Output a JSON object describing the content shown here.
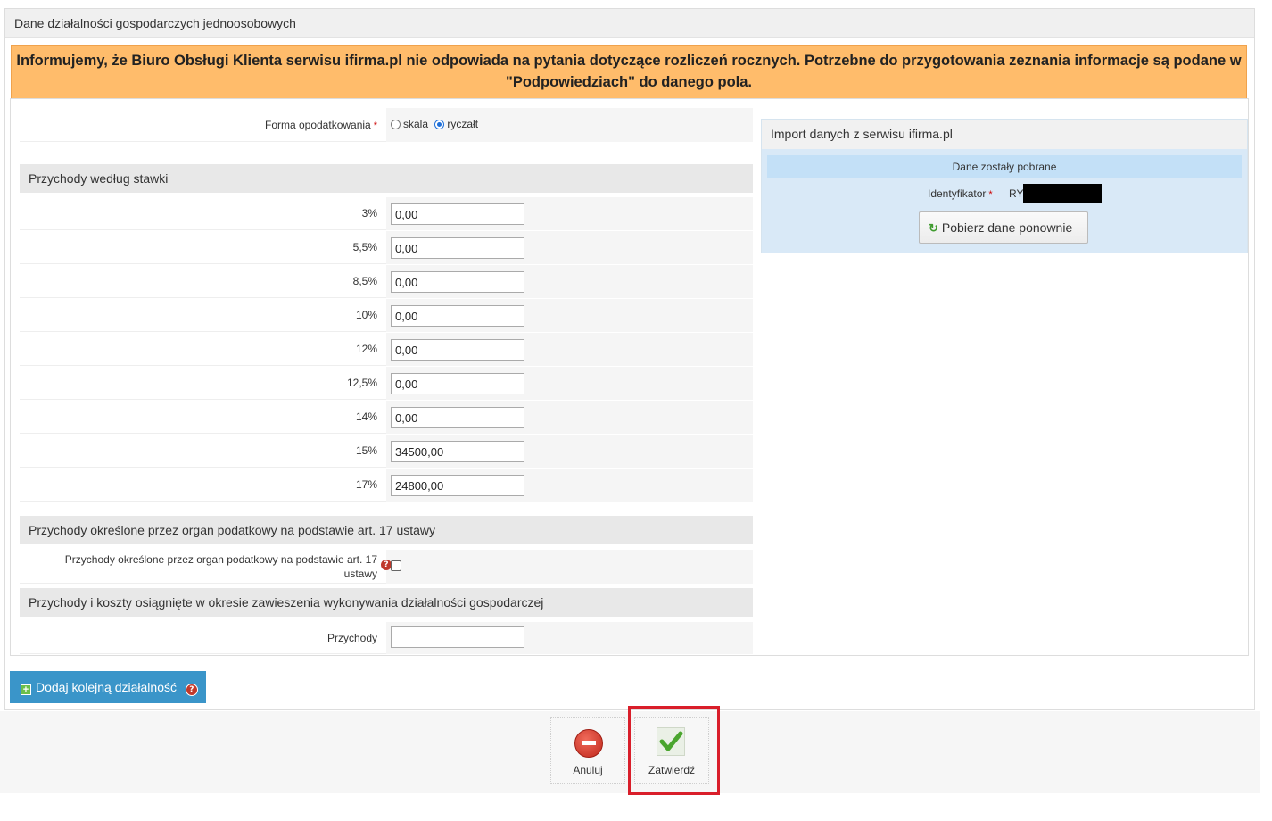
{
  "panel": {
    "title": "Dane działalności gospodarczych jednoosobowych"
  },
  "notice": {
    "text": "Informujemy, że Biuro Obsługi Klienta serwisu ifirma.pl nie odpowiada na pytania dotyczące rozliczeń rocznych. Potrzebne do przygotowania zeznania informacje są podane w \"Podpowiedziach\" do danego pola."
  },
  "taxation": {
    "label": "Forma opodatkowania",
    "required_mark": "*",
    "options": [
      {
        "label": "skala",
        "selected": false
      },
      {
        "label": "ryczałt",
        "selected": true
      }
    ]
  },
  "rates_section": {
    "title": "Przychody według stawki",
    "rows": [
      {
        "label": "3%",
        "value": "0,00"
      },
      {
        "label": "5,5%",
        "value": "0,00"
      },
      {
        "label": "8,5%",
        "value": "0,00"
      },
      {
        "label": "10%",
        "value": "0,00"
      },
      {
        "label": "12%",
        "value": "0,00"
      },
      {
        "label": "12,5%",
        "value": "0,00"
      },
      {
        "label": "14%",
        "value": "0,00"
      },
      {
        "label": "15%",
        "value": "34500,00"
      },
      {
        "label": "17%",
        "value": "24800,00"
      }
    ]
  },
  "art17_section": {
    "title": "Przychody określone przez organ podatkowy na podstawie art. 17 ustawy",
    "field_label_line1": "Przychody określone przez organ podatkowy na podstawie art. 17",
    "field_label_line2": "ustawy",
    "checked": false
  },
  "suspension_section": {
    "title": "Przychody i koszty osiągnięte w okresie zawieszenia wykonywania działalności gospodarczej",
    "field_label": "Przychody",
    "value": ""
  },
  "import": {
    "title": "Import danych z serwisu ifirma.pl",
    "status": "Dane zostały pobrane",
    "id_label": "Identyfikator",
    "id_required_mark": "*",
    "id_value": "RY",
    "refetch_label": "Pobierz dane ponownie"
  },
  "add_button": {
    "label": "Dodaj kolejną działalność"
  },
  "actions": {
    "cancel_label": "Anuluj",
    "confirm_label": "Zatwierdź"
  },
  "icons": {
    "help": "question-circle-icon",
    "refresh": "refresh-icon",
    "plus": "plus-square-icon",
    "cancel": "minus-circle-icon",
    "confirm": "checkmark-icon"
  },
  "colors": {
    "notice_bg": "#ffbc6b",
    "add_button_bg": "#3a95c9",
    "highlight_border": "#d91e2a",
    "import_panel_bg": "#d9e9f7"
  }
}
